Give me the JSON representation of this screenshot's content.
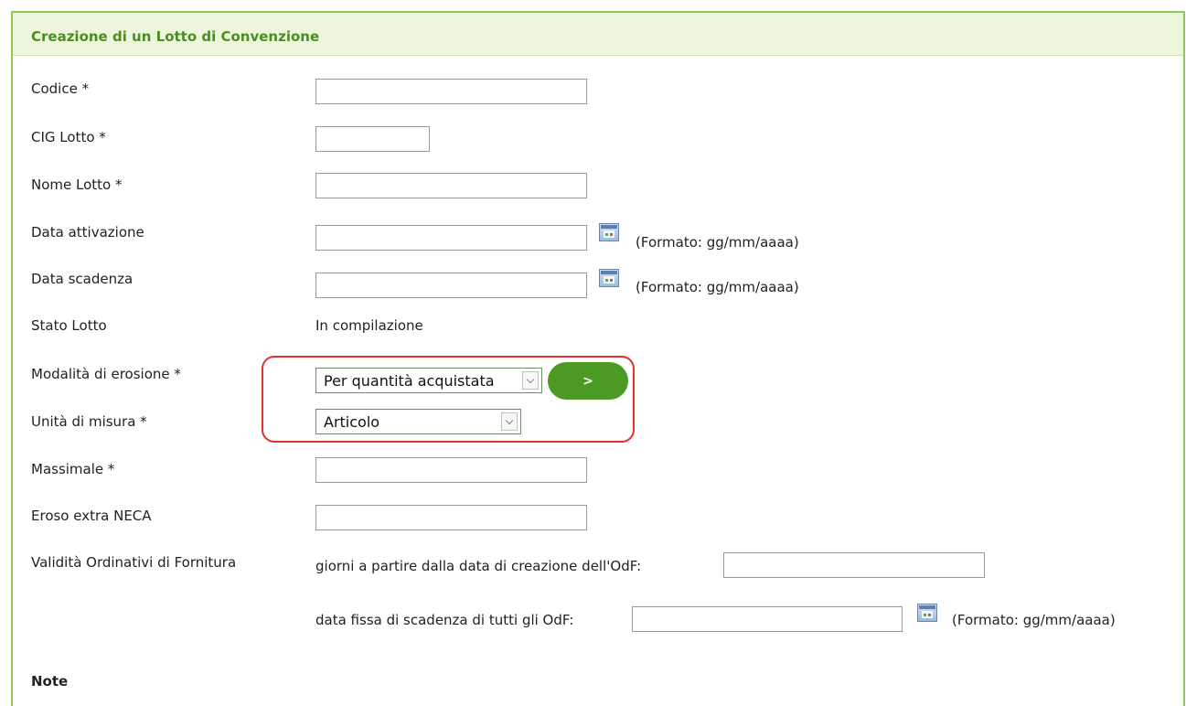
{
  "panel": {
    "title": "Creazione di un Lotto di Convenzione"
  },
  "fields": {
    "codice": {
      "label": "Codice *",
      "value": ""
    },
    "cig_lotto": {
      "label": "CIG Lotto *",
      "value": ""
    },
    "nome_lotto": {
      "label": "Nome Lotto *",
      "value": ""
    },
    "data_attivazione": {
      "label": "Data attivazione",
      "value": "",
      "format_hint": "(Formato: gg/mm/aaaa)"
    },
    "data_scadenza": {
      "label": "Data scadenza",
      "value": "",
      "format_hint": "(Formato: gg/mm/aaaa)"
    },
    "stato_lotto": {
      "label": "Stato Lotto",
      "value": "In compilazione"
    },
    "modalita_erosione": {
      "label": "Modalità di erosione *",
      "selected": "Per quantità acquistata",
      "button_label": ">"
    },
    "unita_misura": {
      "label": "Unità di misura *",
      "selected": "Articolo"
    },
    "massimale": {
      "label": "Massimale *",
      "value": ""
    },
    "eroso_extra_neca": {
      "label": "Eroso extra NECA",
      "value": ""
    },
    "validita_odf": {
      "label": "Validità Ordinativi di Fornitura",
      "giorni_label": "giorni a partire dalla data di creazione dell'OdF:",
      "giorni_value": "",
      "data_fissa_label": "data fissa di scadenza di tutti gli OdF:",
      "data_fissa_value": "",
      "format_hint": "(Formato: gg/mm/aaaa)"
    },
    "note": {
      "label": "Note"
    }
  },
  "colors": {
    "panel_border": "#8cc85a",
    "header_bg": "#eef5dd",
    "title": "#4a8f1e",
    "button": "#4a9a24",
    "highlight": "#e0312f"
  }
}
